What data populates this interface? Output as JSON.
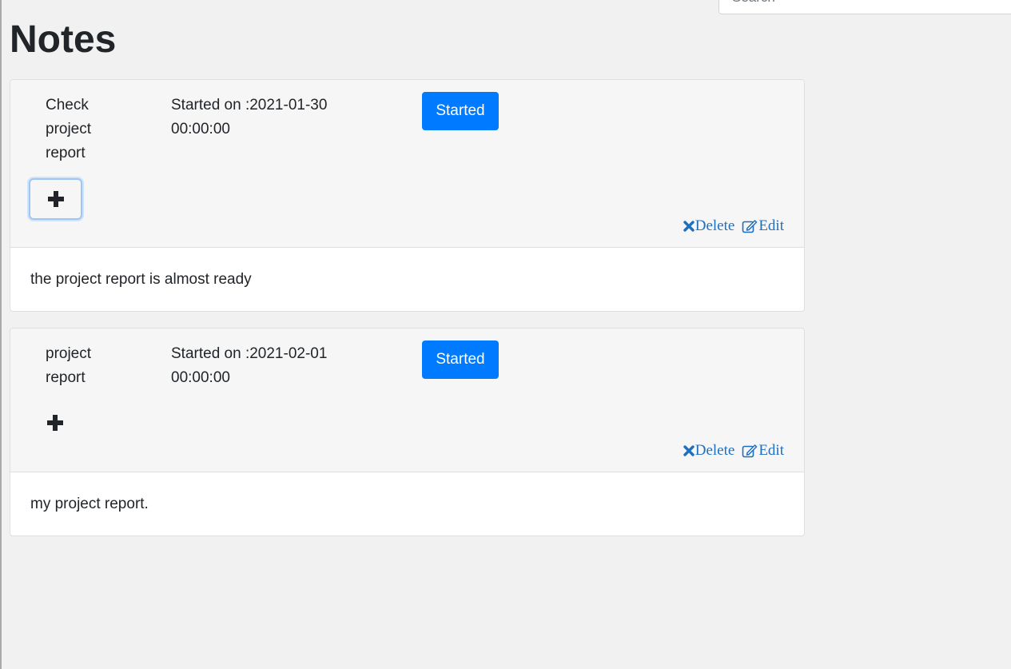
{
  "search": {
    "placeholder": "Search",
    "value": ""
  },
  "page": {
    "title": "Notes"
  },
  "colors": {
    "primary": "#007bff",
    "link": "#1f6fbf",
    "background": "#f1f1f1"
  },
  "notes": [
    {
      "title": "Check project report",
      "date": "Started on :2021-01-30 00:00:00",
      "status": "Started",
      "add_icon": "plus-icon",
      "delete_label": "Delete",
      "delete_icon": "times-icon",
      "edit_label": "Edit",
      "edit_icon": "edit-icon",
      "body": "the project report is almost ready"
    },
    {
      "title": "project report",
      "date": "Started on :2021-02-01 00:00:00",
      "status": "Started",
      "add_icon": "plus-icon",
      "delete_label": "Delete",
      "delete_icon": "times-icon",
      "edit_label": "Edit",
      "edit_icon": "edit-icon",
      "body": "my project report."
    }
  ]
}
